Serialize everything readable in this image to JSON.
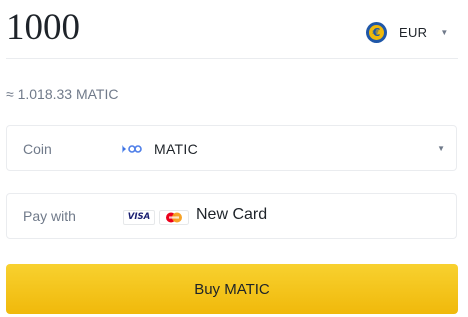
{
  "amount": {
    "value": "1000"
  },
  "currency": {
    "code": "EUR",
    "icon": "euro-coin-icon",
    "symbol": "€",
    "color": "#1f57a8"
  },
  "estimate": {
    "text": "≈ 1.018.33 MATIC"
  },
  "coin": {
    "label": "Coin",
    "value": "MATIC",
    "icon": "matic-coin-icon"
  },
  "payment": {
    "label": "Pay with",
    "value": "New Card",
    "icons": [
      "visa-logo-icon",
      "mastercard-logo-icon"
    ],
    "visa_text": "VISA"
  },
  "buy_button": {
    "label": "Buy MATIC",
    "color": "#f0b90b"
  },
  "colors": {
    "text": "#1e2329",
    "muted": "#707a8a",
    "border": "#eaecef"
  }
}
